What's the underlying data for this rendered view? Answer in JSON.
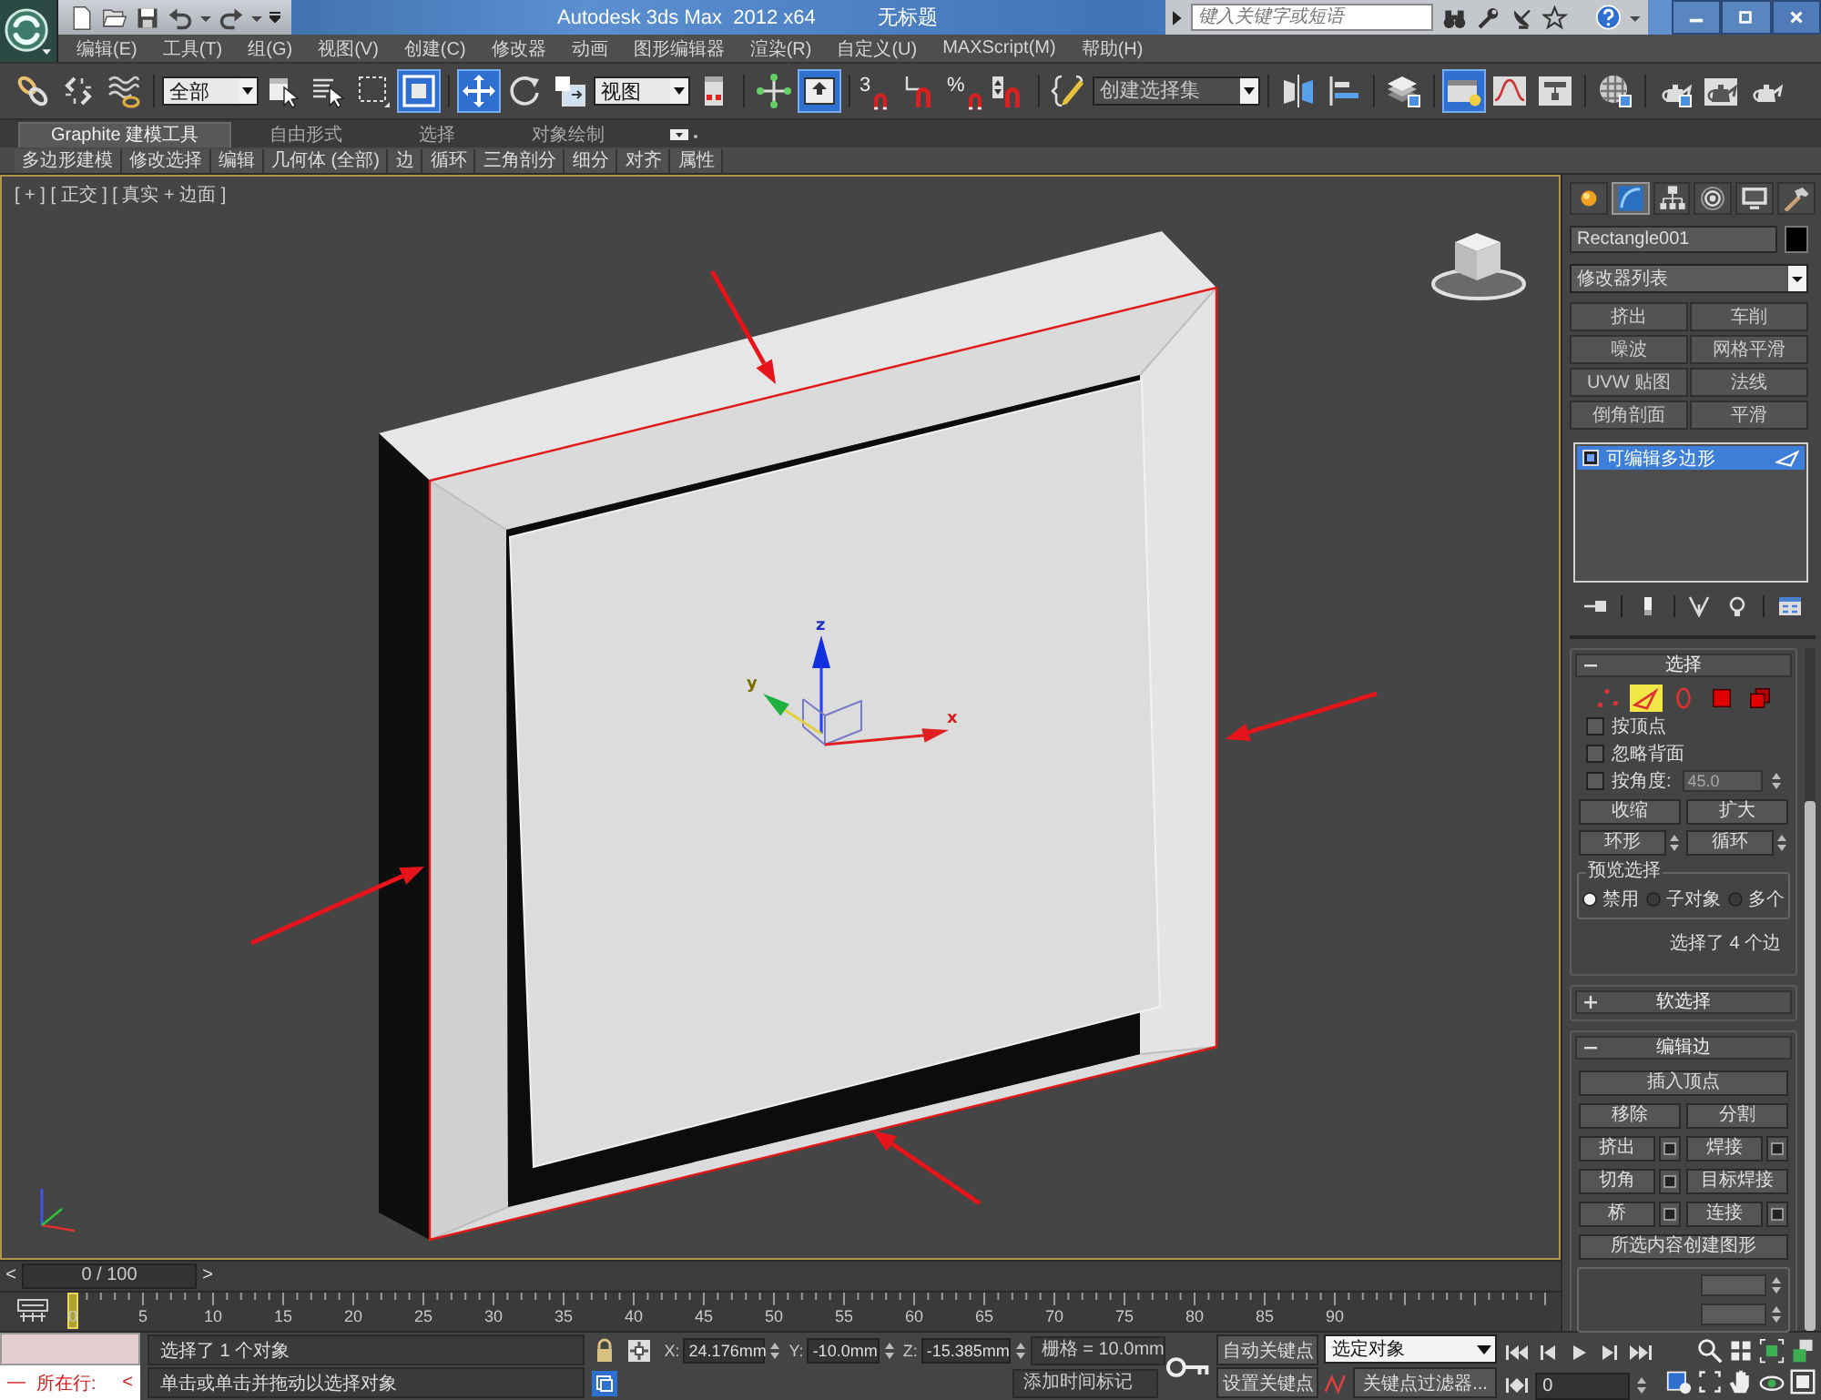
{
  "title_bar": {
    "app_title": "Autodesk 3ds Max  2012 x64",
    "document": "无标题",
    "search_placeholder": "键入关键字或短语"
  },
  "menu": [
    "编辑(E)",
    "工具(T)",
    "组(G)",
    "视图(V)",
    "创建(C)",
    "修改器",
    "动画",
    "图形编辑器",
    "渲染(R)",
    "自定义(U)",
    "MAXScript(M)",
    "帮助(H)"
  ],
  "toolbar": [
    {
      "kind": "link",
      "selected": false
    },
    {
      "kind": "unlink",
      "selected": false
    },
    {
      "kind": "bind",
      "selected": false
    },
    {
      "kind": "separator"
    },
    {
      "kind": "dropdown",
      "value": "全部"
    },
    {
      "kind": "select",
      "selected": false
    },
    {
      "kind": "select_by_name",
      "selected": false
    },
    {
      "kind": "region",
      "selected": false
    },
    {
      "kind": "crossing",
      "selected": true
    },
    {
      "kind": "separator"
    },
    {
      "kind": "move",
      "selected": true
    },
    {
      "kind": "rotate",
      "selected": false
    },
    {
      "kind": "scale",
      "selected": false
    },
    {
      "kind": "dropdown",
      "value": "视图"
    },
    {
      "kind": "pivot",
      "selected": false
    },
    {
      "kind": "separator"
    },
    {
      "kind": "manipulate",
      "selected": false
    },
    {
      "kind": "override",
      "selected": true
    },
    {
      "kind": "separator"
    },
    {
      "kind": "snap",
      "label": "3",
      "selected": false
    },
    {
      "kind": "angle_snap",
      "selected": false
    },
    {
      "kind": "percent_snap",
      "label": "%",
      "selected": false
    },
    {
      "kind": "spinner_snap",
      "selected": false
    },
    {
      "kind": "separator"
    },
    {
      "kind": "named_sets",
      "selected": false
    },
    {
      "kind": "dropdown",
      "placeholder": "创建选择集"
    },
    {
      "kind": "separator"
    },
    {
      "kind": "mirror",
      "selected": false
    },
    {
      "kind": "align",
      "selected": false
    },
    {
      "kind": "separator"
    },
    {
      "kind": "layers",
      "selected": false
    },
    {
      "kind": "separator"
    },
    {
      "kind": "ribbon",
      "selected": true
    },
    {
      "kind": "curves",
      "selected": false
    },
    {
      "kind": "schematic",
      "selected": false
    },
    {
      "kind": "separator"
    },
    {
      "kind": "material",
      "selected": false
    },
    {
      "kind": "separator"
    },
    {
      "kind": "render_setup",
      "selected": false
    },
    {
      "kind": "render_frame",
      "selected": false
    },
    {
      "kind": "render",
      "selected": false
    }
  ],
  "ribbon": {
    "tabs": [
      {
        "label": "Graphite 建模工具",
        "selected": true
      },
      {
        "label": "自由形式",
        "selected": false
      },
      {
        "label": "选择",
        "selected": false
      },
      {
        "label": "对象绘制",
        "selected": false
      }
    ],
    "panels": [
      "多边形建模",
      "修改选择",
      "编辑",
      "几何体 (全部)",
      "边",
      "循环",
      "三角剖分",
      "细分",
      "对齐",
      "属性"
    ]
  },
  "viewport": {
    "label": "[ + ] [ 正交 ] [ 真实 + 边面 ]",
    "gizmo_labels": [
      "x",
      "y",
      "z"
    ]
  },
  "command_panel": {
    "tabs": [
      {
        "kind": "create",
        "selected": false
      },
      {
        "kind": "modify",
        "selected": true
      },
      {
        "kind": "hierarchy",
        "selected": false
      },
      {
        "kind": "motion",
        "selected": false
      },
      {
        "kind": "display",
        "selected": false
      },
      {
        "kind": "utilities",
        "selected": false
      }
    ],
    "object_name": "Rectangle001",
    "modifier_list": "修改器列表",
    "modifier_buttons": [
      "挤出",
      "车削",
      "噪波",
      "网格平滑",
      "UVW 贴图",
      "法线",
      "倒角剖面",
      "平滑"
    ],
    "stack": [
      {
        "label": "可编辑多边形",
        "selected": true
      }
    ],
    "selection": {
      "title": "选择",
      "expanded": true,
      "subobjects": [
        {
          "kind": "vertex",
          "selected": false
        },
        {
          "kind": "edge",
          "selected": true
        },
        {
          "kind": "border",
          "selected": false
        },
        {
          "kind": "polygon",
          "selected": false
        },
        {
          "kind": "element",
          "selected": false
        }
      ],
      "options": [
        {
          "label": "按顶点",
          "checked": false
        },
        {
          "label": "忽略背面",
          "checked": false
        },
        {
          "label": "按角度:",
          "checked": false,
          "value": "45.0"
        }
      ],
      "shrink": "收缩",
      "grow": "扩大",
      "ring": "环形",
      "loop": "循环",
      "preview": {
        "title": "预览选择",
        "options": [
          {
            "label": "禁用",
            "selected": true
          },
          {
            "label": "子对象",
            "selected": false
          },
          {
            "label": "多个",
            "selected": false
          }
        ]
      },
      "status": "选择了 4 个边"
    },
    "soft_selection": {
      "title": "软选择",
      "expanded": false
    },
    "edit_edges": {
      "title": "编辑边",
      "expanded": true,
      "buttons": [
        {
          "label": "插入顶点",
          "kind": "wide"
        },
        {
          "label": "移除",
          "kind": "plain"
        },
        {
          "label": "分割",
          "kind": "plain"
        },
        {
          "label": "挤出",
          "kind": "settings"
        },
        {
          "label": "焊接",
          "kind": "settings"
        },
        {
          "label": "切角",
          "kind": "settings"
        },
        {
          "label": "目标焊接",
          "kind": "plain"
        },
        {
          "label": "桥",
          "kind": "settings"
        },
        {
          "label": "连接",
          "kind": "settings"
        },
        {
          "label": "所选内容创建图形",
          "kind": "wide"
        }
      ]
    }
  },
  "time_slider": {
    "prev": "<",
    "position": "0 / 100",
    "next": ">"
  },
  "track_bar": {
    "labels": [
      "0",
      "5",
      "10",
      "15",
      "20",
      "25",
      "30",
      "35",
      "40",
      "45",
      "50",
      "55",
      "60",
      "65",
      "70",
      "75",
      "80",
      "85",
      "90"
    ]
  },
  "status_bar": {
    "listener": {
      "dash": "—",
      "label": "所在行:",
      "arrow": "<"
    },
    "prompt": "选择了 1 个对象",
    "hint": "单击或单击并拖动以选择对象",
    "coords": [
      {
        "axis": "X:",
        "value": "24.176mm"
      },
      {
        "axis": "Y:",
        "value": "-10.0mm"
      },
      {
        "axis": "Z:",
        "value": "-15.385mm"
      }
    ],
    "grid": "栅格 = 10.0mm",
    "time_tag": "添加时间标记",
    "auto_key": "自动关键点",
    "set_key": "设置关键点",
    "key_mode": "选定对象",
    "key_filters": "关键点过滤器...",
    "frame": "0"
  }
}
